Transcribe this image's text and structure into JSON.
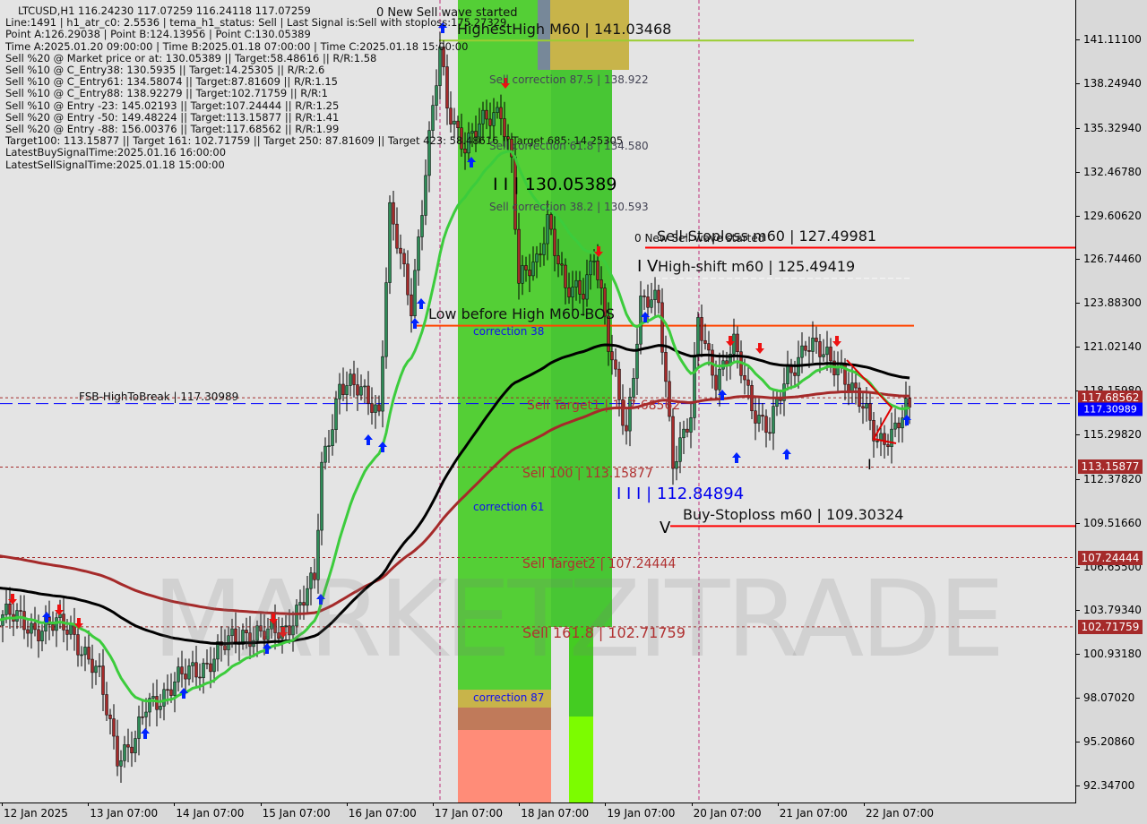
{
  "window": {
    "symbol_line": "LTCUSD,H1  116.24230 117.07259 116.24118 117.07259"
  },
  "info_lines": [
    "Line:1491 | h1_atr_c0: 2.5536 | tema_h1_status: Sell | Last Signal is:Sell with stoploss:175.27329",
    "Point A:126.29038 | Point B:124.13956 | Point C:130.05389",
    "Time A:2025.01.20 09:00:00 | Time B:2025.01.18 07:00:00 | Time C:2025.01.18 15:00:00",
    "Sell %20 @ Market price or at: 130.05389 || Target:58.48616 || R/R:1.58",
    "Sell %10 @ C_Entry38: 130.5935 || Target:14.25305 || R/R:2.6",
    "Sell %10 @ C_Entry61: 134.58074 || Target:87.81609 || R/R:1.15",
    "Sell %10 @ C_Entry88: 138.92279 || Target:102.71759 || R/R:1",
    "Sell %10 @ Entry -23: 145.02193 || Target:107.24444 || R/R:1.25",
    "Sell %20 @ Entry -50: 149.48224 || Target:113.15877 || R/R:1.41",
    "Sell %20 @ Entry -88: 156.00376 || Target:117.68562 || R/R:1.99",
    "Target100: 113.15877 || Target 161: 102.71759 || Target 250: 87.81609 || Target 423: 58.48616 || Target 685: 14.25305",
    "LatestBuySignalTime:2025.01.16 16:00:00",
    "LatestSellSignalTime:2025.01.18 15:00:00"
  ],
  "annotations": {
    "new_sell_wave_top": "0 New Sell wave started",
    "highest_high": "HighestHigh   M60 | 141.03468",
    "sell_corr_875": "Sell correction 87.5 | 138.922",
    "sell_corr_618": "Sell correction 61.8 | 134.580",
    "point_c": "I I | 130.05389",
    "sell_corr_382": "Sell correction 38.2 | 130.593",
    "new_sell_wave_mid": "0 New Sell wave started",
    "sell_stoploss": "Sell-Stoploss m60 | 127.49981",
    "iv_mark": "I V",
    "high_shift": "High-shift m60 | 125.49419",
    "low_before_high": "Low before High    M60-BOS",
    "correction_38": "correction 38",
    "fsb": "FSB-HighToBreak | 117.30989",
    "sell_target1": "Sell Target1 | 117.68562",
    "sell_100": "Sell 100 | 113.15877",
    "point_iii": "I I I | 112.84894",
    "correction_61": "correction 61",
    "buy_stoploss": "Buy-Stoploss m60 | 109.30324",
    "v_mark": "V",
    "sell_target2": "Sell Target2 | 107.24444",
    "sell_1618": "Sell 161.8 | 102.71759",
    "correction_87": "correction 87",
    "i_mark": "I"
  },
  "watermark": {
    "bold": "MARKETZI",
    "light": "TRADE"
  },
  "colors": {
    "bull": "#2e8b57",
    "bear": "#a52a2a",
    "fast_ma": "#3ccc3c",
    "mid_ma": "#000000",
    "slow_ma": "#a52a2a",
    "zone_green": "#44cc22",
    "stop_red": "#ff0000",
    "fsb_blue": "#0000ff",
    "badge": "#a52a2a"
  },
  "y_axis": {
    "ticks": [
      "141.11100",
      "138.24940",
      "135.32940",
      "132.46780",
      "129.60620",
      "126.74460",
      "123.88300",
      "121.02140",
      "118.15980",
      "115.29820",
      "112.37820",
      "109.51660",
      "106.65500",
      "103.79340",
      "100.93180",
      "98.07020",
      "95.20860",
      "92.34700"
    ],
    "badges": [
      "117.68562",
      "113.15877",
      "107.24444",
      "102.71759"
    ],
    "current_badge": "117.30989"
  },
  "x_axis": {
    "ticks": [
      "12 Jan 2025",
      "13 Jan 07:00",
      "14 Jan 07:00",
      "15 Jan 07:00",
      "16 Jan 07:00",
      "17 Jan 07:00",
      "18 Jan 07:00",
      "19 Jan 07:00",
      "20 Jan 07:00",
      "21 Jan 07:00",
      "22 Jan 07:00"
    ]
  },
  "chart_data": {
    "type": "candlestick",
    "symbol": "LTCUSD",
    "timeframe": "H1",
    "ylim": [
      92.347,
      141.111
    ],
    "approx_close_path": [
      [
        "2025-01-12 06:00",
        103.6
      ],
      [
        "2025-01-12 16:00",
        102.7
      ],
      [
        "2025-01-13 02:00",
        102.7
      ],
      [
        "2025-01-13 10:00",
        99.2
      ],
      [
        "2025-01-13 15:00",
        94.5
      ],
      [
        "2025-01-13 20:00",
        95.1
      ],
      [
        "2025-01-13 23:00",
        97.4
      ],
      [
        "2025-01-14 06:00",
        98.9
      ],
      [
        "2025-01-14 16:00",
        100.4
      ],
      [
        "2025-01-15 02:00",
        102.4
      ],
      [
        "2025-01-15 09:00",
        102.1
      ],
      [
        "2025-01-15 14:00",
        102.7
      ],
      [
        "2025-01-15 22:00",
        105.6
      ],
      [
        "2025-01-16 00:00",
        113.2
      ],
      [
        "2025-01-16 05:00",
        118.5
      ],
      [
        "2025-01-16 13:00",
        117.9
      ],
      [
        "2025-01-16 16:00",
        116.8
      ],
      [
        "2025-01-16 19:00",
        129.6
      ],
      [
        "2025-01-17 01:00",
        123.8
      ],
      [
        "2025-01-17 05:00",
        132.6
      ],
      [
        "2025-01-17 09:00",
        140.2
      ],
      [
        "2025-01-17 11:00",
        136.7
      ],
      [
        "2025-01-17 16:00",
        134.3
      ],
      [
        "2025-01-17 21:00",
        135.5
      ],
      [
        "2025-01-18 02:00",
        136.7
      ],
      [
        "2025-01-18 05:00",
        133.2
      ],
      [
        "2025-01-18 07:00",
        125.0
      ],
      [
        "2025-01-18 12:00",
        126.7
      ],
      [
        "2025-01-18 15:00",
        129.6
      ],
      [
        "2025-01-18 20:00",
        124.4
      ],
      [
        "2025-01-19 01:00",
        125.0
      ],
      [
        "2025-01-19 04:00",
        127.3
      ],
      [
        "2025-01-19 08:00",
        120.9
      ],
      [
        "2025-01-19 13:00",
        115.6
      ],
      [
        "2025-01-19 17:00",
        123.8
      ],
      [
        "2025-01-19 22:00",
        123.8
      ],
      [
        "2025-01-20 02:00",
        113.8
      ],
      [
        "2025-01-20 07:00",
        116.2
      ],
      [
        "2025-01-20 09:00",
        122.6
      ],
      [
        "2025-01-20 14:00",
        119.1
      ],
      [
        "2025-01-20 19:00",
        120.9
      ],
      [
        "2025-01-21 00:00",
        117.3
      ],
      [
        "2025-01-21 05:00",
        115.6
      ],
      [
        "2025-01-21 10:00",
        119.1
      ],
      [
        "2025-01-21 15:00",
        121.4
      ],
      [
        "2025-01-21 20:00",
        120.3
      ],
      [
        "2025-01-22 01:00",
        119.7
      ],
      [
        "2025-01-22 06:00",
        117.3
      ],
      [
        "2025-01-22 11:00",
        115.0
      ],
      [
        "2025-01-22 16:00",
        115.6
      ],
      [
        "2025-01-22 20:00",
        117.07259
      ]
    ],
    "levels": [
      {
        "label": "HighestHigh M60",
        "value": 141.03468
      },
      {
        "label": "Sell-Stoploss m60",
        "value": 127.49981
      },
      {
        "label": "High-shift m60",
        "value": 125.49419
      },
      {
        "label": "Low before High M60-BOS",
        "value": 122.4
      },
      {
        "label": "Sell Target1",
        "value": 117.68562
      },
      {
        "label": "FSB-HighToBreak",
        "value": 117.30989
      },
      {
        "label": "Sell 100",
        "value": 113.15877
      },
      {
        "label": "Buy-Stoploss m60",
        "value": 109.30324
      },
      {
        "label": "Sell Target2",
        "value": 107.24444
      },
      {
        "label": "Sell 161.8",
        "value": 102.71759
      }
    ]
  }
}
